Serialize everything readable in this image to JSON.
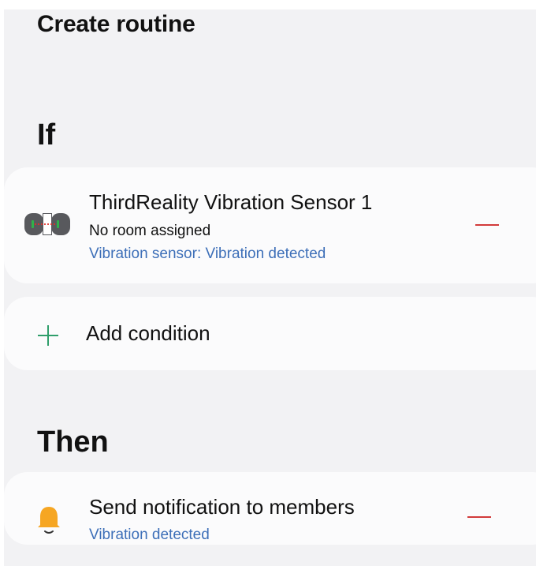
{
  "header": {
    "title": "Create routine"
  },
  "if_section": {
    "title": "If",
    "conditions": [
      {
        "device_name": "ThirdReality Vibration Sensor 1",
        "room": "No room assigned",
        "state": "Vibration sensor: Vibration detected",
        "icon": "vibration-sensor-icon"
      }
    ],
    "add_condition_label": "Add condition",
    "add_icon": "plus-icon"
  },
  "then_section": {
    "title": "Then",
    "actions": [
      {
        "name": "Send notification to members",
        "detail": "Vibration detected",
        "icon": "bell-icon"
      }
    ]
  },
  "colors": {
    "background": "#f2f2f4",
    "card": "#fbfbfc",
    "link_blue": "#3d6fb8",
    "remove_red": "#d23a3a",
    "add_green": "#2f9e6b",
    "bell_orange": "#f6a623"
  }
}
